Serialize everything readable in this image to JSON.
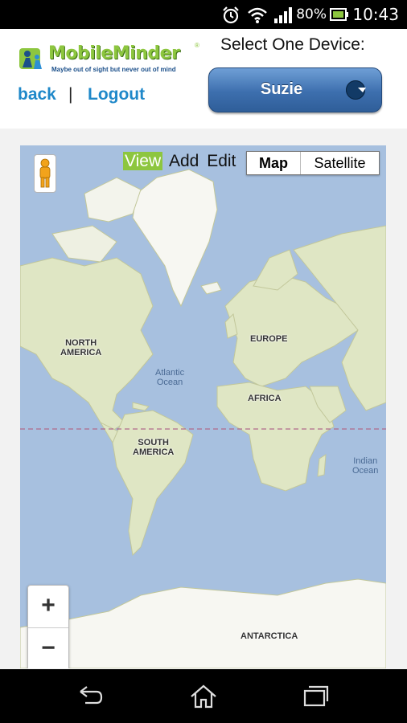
{
  "status_bar": {
    "battery_percent": "80%",
    "time": "10:43",
    "icons": [
      "alarm-icon",
      "wifi-icon",
      "signal-icon",
      "battery-icon"
    ]
  },
  "header": {
    "logo_name": "MobileMinder",
    "logo_tagline": "Maybe out of sight but never out of mind",
    "logo_reg": "®",
    "back_label": "back",
    "separator": "|",
    "logout_label": "Logout",
    "select_label": "Select One Device:",
    "device_selected": "Suzie"
  },
  "map": {
    "modes": {
      "view": "View",
      "add": "Add",
      "edit": "Edit",
      "active": "view"
    },
    "map_type_map": "Map",
    "map_type_satellite": "Satellite",
    "map_type_selected": "Map",
    "zoom_in": "+",
    "zoom_out": "−",
    "labels": {
      "north_america": "NORTH\nAMERICA",
      "south_america": "SOUTH\nAMERICA",
      "europe": "EUROPE",
      "africa": "AFRICA",
      "antarctica": "ANTARCTICA",
      "atlantic": "Atlantic\nOcean",
      "indian": "Indian\nOcean"
    }
  },
  "colors": {
    "accent_green": "#8dc63f",
    "link_blue": "#1f88c9",
    "button_blue": "#3d6fae",
    "ocean": "#a7c0df",
    "land": "#dfe6c4"
  }
}
